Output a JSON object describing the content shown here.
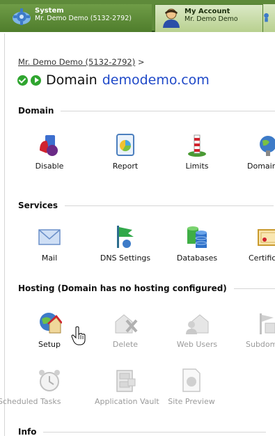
{
  "nav": {
    "system": {
      "title": "System",
      "subtitle": "Mr. Demo Demo (5132-2792)"
    },
    "account": {
      "title": "My Account",
      "subtitle": "Mr. Demo Demo"
    }
  },
  "breadcrumb": {
    "link": "Mr. Demo Demo (5132-2792)",
    "separator": ">"
  },
  "page_title": {
    "label": "Domain",
    "domain": "demodemo.com"
  },
  "sections": {
    "domain": {
      "title": "Domain",
      "items": [
        {
          "label": "Disable",
          "icon": "disable-icon"
        },
        {
          "label": "Report",
          "icon": "report-icon"
        },
        {
          "label": "Limits",
          "icon": "limits-icon"
        },
        {
          "label": "Domain A",
          "icon": "domain-aliases-icon"
        }
      ]
    },
    "services": {
      "title": "Services",
      "items": [
        {
          "label": "Mail",
          "icon": "mail-icon"
        },
        {
          "label": "DNS Settings",
          "icon": "dns-settings-icon"
        },
        {
          "label": "Databases",
          "icon": "databases-icon"
        },
        {
          "label": "Certific",
          "icon": "certificates-icon"
        }
      ]
    },
    "hosting": {
      "title": "Hosting (Domain has no hosting configured)",
      "items": [
        {
          "label": "Setup",
          "icon": "setup-icon"
        },
        {
          "label": "Delete",
          "icon": "delete-icon"
        },
        {
          "label": "Web Users",
          "icon": "web-users-icon"
        },
        {
          "label": "Subdoma",
          "icon": "subdomains-icon"
        },
        {
          "label": "Scheduled Tasks",
          "icon": "scheduled-tasks-icon"
        },
        {
          "label": "Application Vault",
          "icon": "application-vault-icon"
        },
        {
          "label": "Site Preview",
          "icon": "site-preview-icon"
        }
      ]
    },
    "info": {
      "title": "Info"
    }
  },
  "colors": {
    "topbar": "#5e8a3a",
    "domain_link": "#1f49c8",
    "status_ok": "#2fa52f"
  }
}
